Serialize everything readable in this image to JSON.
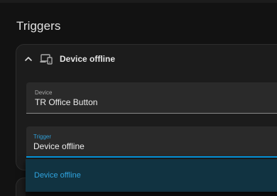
{
  "section": {
    "title": "Triggers"
  },
  "trigger_card": {
    "title": "Device offline",
    "icons": {
      "collapse": "chevron-up-icon",
      "device": "devices-icon"
    },
    "device_field": {
      "label": "Device",
      "value": "TR Office Button"
    },
    "trigger_field": {
      "label": "Trigger",
      "value": "Device offline"
    }
  },
  "dropdown": {
    "options": [
      {
        "label": "Device offline",
        "selected": true
      }
    ]
  },
  "colors": {
    "background": "#121212",
    "card": "#1c1c1c",
    "accent": "#039be5",
    "selected_option_bg": "#113341"
  }
}
